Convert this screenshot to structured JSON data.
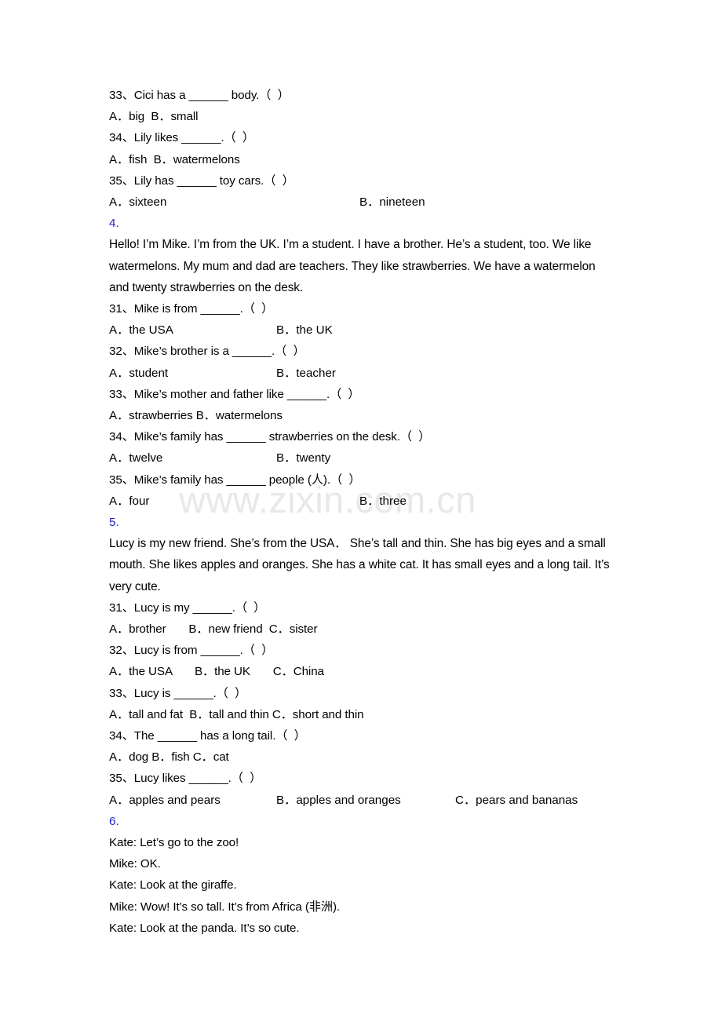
{
  "watermark": {
    "text": "www.zixin.com.cn",
    "color": "#e8e8e8"
  },
  "colors": {
    "section_number": "#2222cc",
    "text": "#000000"
  },
  "sections": [
    {
      "id": "section-3-tail",
      "questions": [
        {
          "stem": "33、Cici has a ______ body.（  ）",
          "options_inline": "A．big  B．small"
        },
        {
          "stem": "34、Lily likes ______.（  ）",
          "options_inline": "A．fish  B．watermelons"
        },
        {
          "stem": "35、Lily has ______ toy cars.（  ）",
          "option_a": "A．sixteen",
          "option_b": "B．nineteen"
        }
      ]
    },
    {
      "id": "section-4",
      "number": "4.",
      "passage": "Hello! I’m Mike. I’m from the UK. I’m a student. I have a brother. He’s a student, too. We like watermelons. My mum and dad are teachers. They like strawberries. We have a watermelon and twenty strawberries on the desk.",
      "questions": [
        {
          "stem": "31、Mike is from ______.（  ）",
          "option_a": "A．the USA",
          "option_b": "B．the UK"
        },
        {
          "stem": "32、Mike’s brother is a ______.（  ）",
          "option_a": "A．student",
          "option_b": "B．teacher"
        },
        {
          "stem": "33、Mike’s mother and father like ______.（  ）",
          "options_inline": "A．strawberries B．watermelons"
        },
        {
          "stem": "34、Mike’s family has ______ strawberries on the desk.（  ）",
          "option_a": "A．twelve",
          "option_b": "B．twenty"
        },
        {
          "stem": "35、Mike’s family has ______ people (人).（  ）",
          "option_a": "A．four",
          "option_b": "B．three"
        }
      ]
    },
    {
      "id": "section-5",
      "number": "5.",
      "passage": "Lucy is my new friend. She’s from the USA．  She’s tall and thin. She has big eyes and a small mouth. She likes apples and oranges. She has a white cat. It has small eyes and a long tail. It’s very cute.",
      "questions": [
        {
          "stem": "31、Lucy is my ______.（  ）",
          "options_inline": "A．brother       B．new friend  C．sister"
        },
        {
          "stem": "32、Lucy is from ______.（  ）",
          "options_inline": "A．the USA       B．the UK       C．China"
        },
        {
          "stem": "33、Lucy is ______.（  ）",
          "options_inline": "A．tall and fat  B．tall and thin C．short and thin"
        },
        {
          "stem": "34、The ______ has a long tail.（  ）",
          "options_inline": "A．dog B．fish C．cat"
        },
        {
          "stem": "35、Lucy likes ______.（  ）",
          "option_a": "A．apples and pears",
          "option_b": "B．apples and oranges",
          "option_c": "C．pears and bananas"
        }
      ]
    },
    {
      "id": "section-6",
      "number": "6.",
      "dialogue": [
        "Kate: Let’s go to the zoo!",
        "Mike: OK.",
        "Kate: Look at the giraffe.",
        "Mike: Wow! It’s so tall. It’s from Africa (非洲).",
        "Kate: Look at the panda. It’s so cute."
      ]
    }
  ]
}
